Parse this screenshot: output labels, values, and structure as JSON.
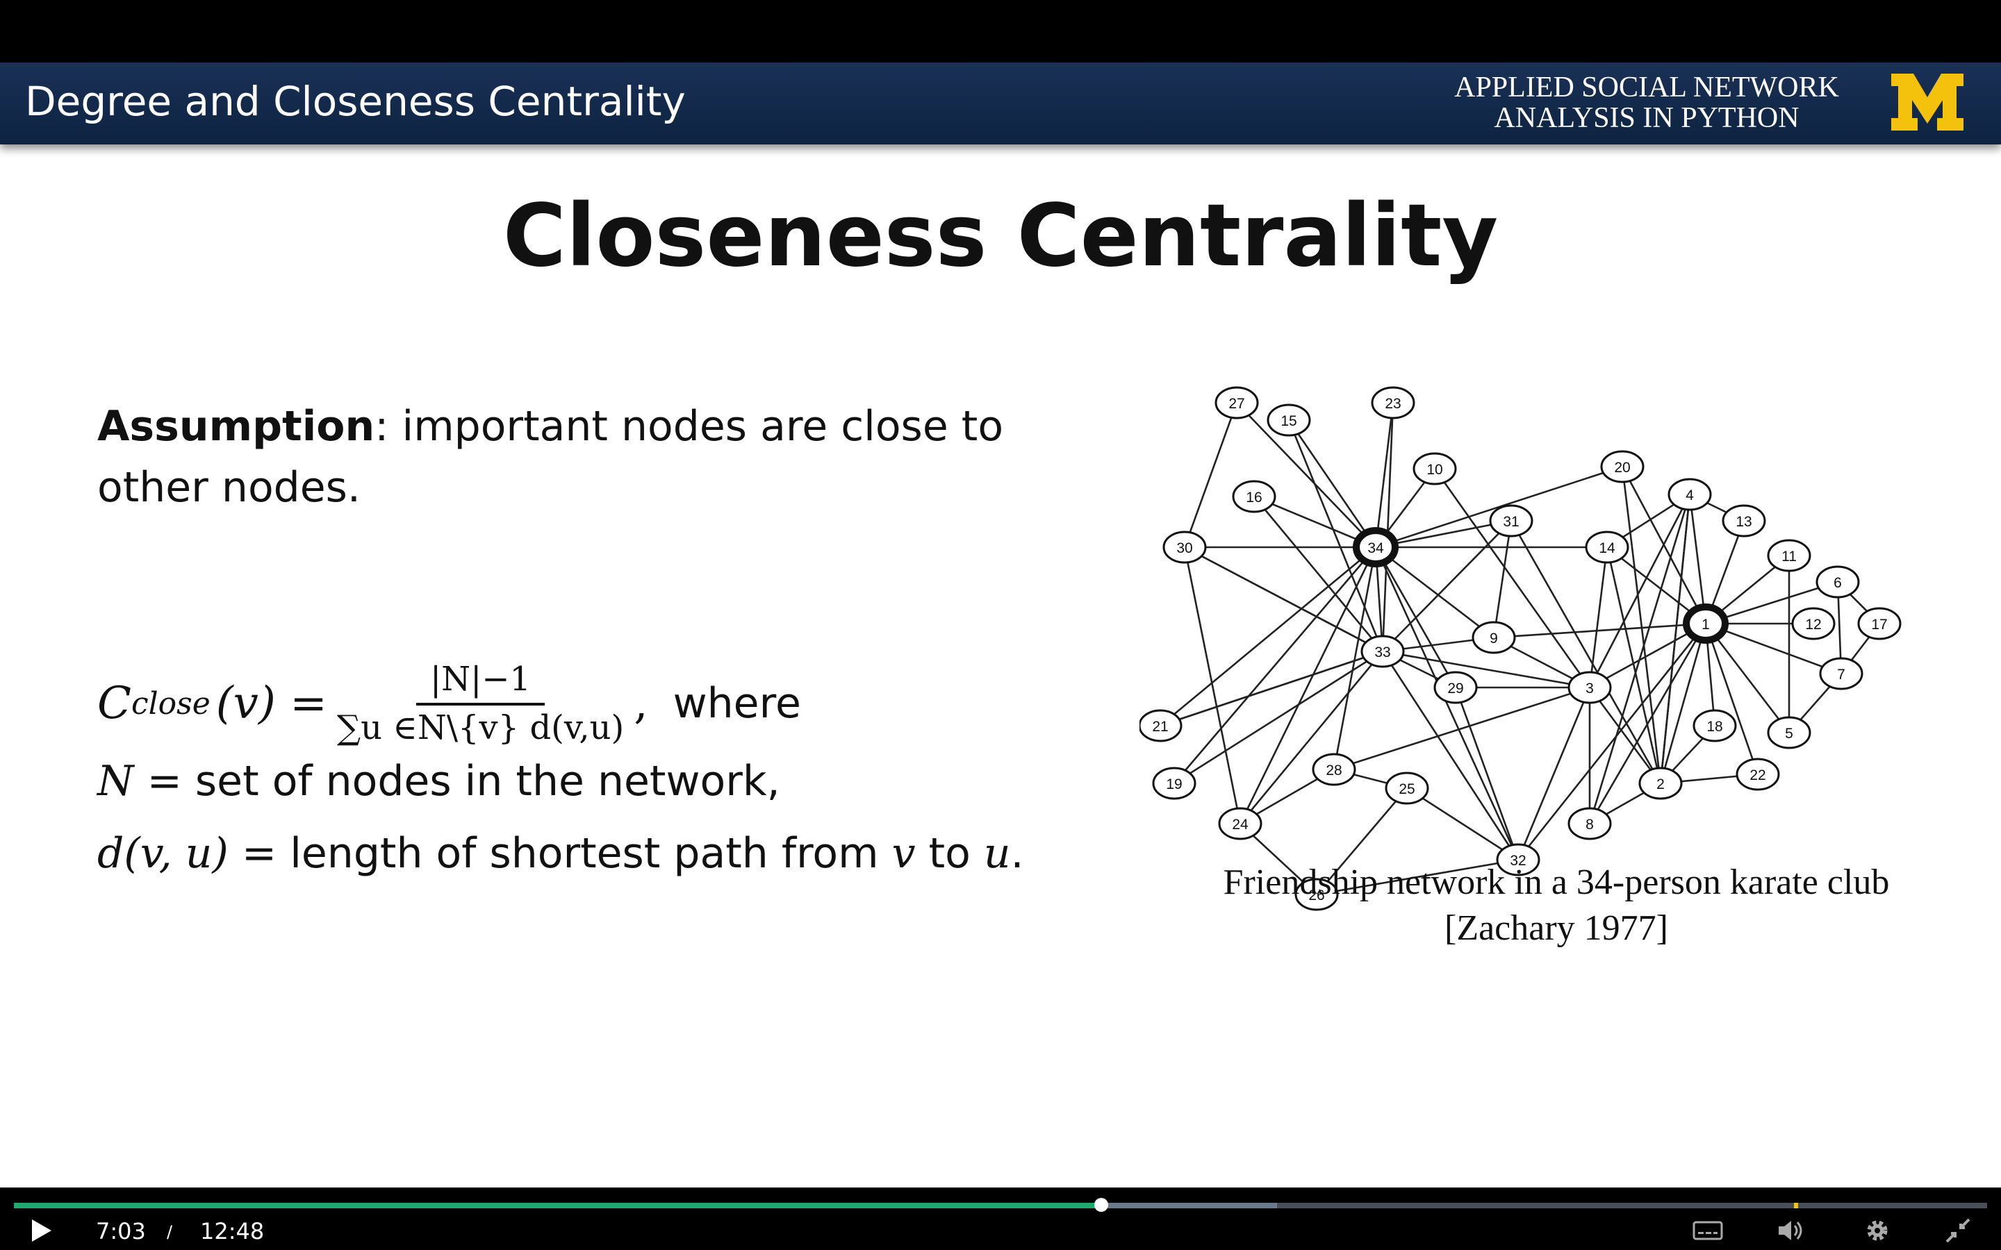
{
  "slide": {
    "header_title": "Degree and Closeness Centrality",
    "course_line1": "APPLIED SOCIAL NETWORK",
    "course_line2": "ANALYSIS IN PYTHON",
    "logo_text": "M",
    "heading": "Closeness Centrality",
    "assumption_label": "Assumption",
    "assumption_text": ": important nodes are close to other nodes.",
    "formula": {
      "lhs_C": "C",
      "lhs_sub": "close",
      "lhs_arg": "(v) =",
      "numerator": "|N|−1",
      "denominator": "∑u ∈N\\{v} d(v,u)",
      "comma": ",",
      "where": "where"
    },
    "def_N_symbol": "N",
    "def_N_text": " = set of nodes in the network,",
    "def_d_symbol": "d(v, u)",
    "def_d_text": " = length of shortest path from ",
    "def_d_v": "v",
    "def_d_to": " to ",
    "def_d_u": "u",
    "def_d_end": ".",
    "caption_line1": "Friendship network in a 34-person karate club",
    "caption_line2": "[Zachary 1977]"
  },
  "network": {
    "nodes": [
      "27",
      "15",
      "23",
      "10",
      "16",
      "34",
      "31",
      "20",
      "4",
      "13",
      "11",
      "6",
      "17",
      "30",
      "14",
      "1",
      "12",
      "7",
      "21",
      "33",
      "9",
      "29",
      "3",
      "18",
      "5",
      "22",
      "19",
      "28",
      "25",
      "2",
      "24",
      "8",
      "32",
      "26"
    ],
    "highlighted": [
      "34",
      "1"
    ],
    "edges": [
      [
        "27",
        "30"
      ],
      [
        "27",
        "34"
      ],
      [
        "15",
        "34"
      ],
      [
        "15",
        "33"
      ],
      [
        "23",
        "34"
      ],
      [
        "23",
        "33"
      ],
      [
        "10",
        "34"
      ],
      [
        "10",
        "3"
      ],
      [
        "16",
        "34"
      ],
      [
        "16",
        "33"
      ],
      [
        "30",
        "34"
      ],
      [
        "30",
        "33"
      ],
      [
        "30",
        "24"
      ],
      [
        "21",
        "34"
      ],
      [
        "21",
        "33"
      ],
      [
        "19",
        "34"
      ],
      [
        "19",
        "33"
      ],
      [
        "34",
        "31"
      ],
      [
        "34",
        "20"
      ],
      [
        "34",
        "14"
      ],
      [
        "34",
        "9"
      ],
      [
        "34",
        "29"
      ],
      [
        "34",
        "28"
      ],
      [
        "34",
        "32"
      ],
      [
        "34",
        "24"
      ],
      [
        "34",
        "33"
      ],
      [
        "33",
        "31"
      ],
      [
        "33",
        "9"
      ],
      [
        "33",
        "3"
      ],
      [
        "33",
        "29"
      ],
      [
        "33",
        "32"
      ],
      [
        "33",
        "24"
      ],
      [
        "33",
        "21"
      ],
      [
        "33",
        "30"
      ],
      [
        "31",
        "9"
      ],
      [
        "31",
        "2"
      ],
      [
        "9",
        "1"
      ],
      [
        "9",
        "3"
      ],
      [
        "29",
        "3"
      ],
      [
        "29",
        "32"
      ],
      [
        "28",
        "24"
      ],
      [
        "28",
        "25"
      ],
      [
        "28",
        "3"
      ],
      [
        "25",
        "26"
      ],
      [
        "25",
        "32"
      ],
      [
        "24",
        "26"
      ],
      [
        "26",
        "32"
      ],
      [
        "32",
        "3"
      ],
      [
        "32",
        "1"
      ],
      [
        "20",
        "1"
      ],
      [
        "20",
        "2"
      ],
      [
        "14",
        "1"
      ],
      [
        "14",
        "2"
      ],
      [
        "14",
        "3"
      ],
      [
        "14",
        "4"
      ],
      [
        "4",
        "1"
      ],
      [
        "4",
        "2"
      ],
      [
        "4",
        "3"
      ],
      [
        "13",
        "1"
      ],
      [
        "13",
        "4"
      ],
      [
        "11",
        "1"
      ],
      [
        "11",
        "5"
      ],
      [
        "6",
        "1"
      ],
      [
        "6",
        "17"
      ],
      [
        "6",
        "7"
      ],
      [
        "17",
        "7"
      ],
      [
        "12",
        "1"
      ],
      [
        "7",
        "1"
      ],
      [
        "5",
        "1"
      ],
      [
        "5",
        "7"
      ],
      [
        "22",
        "1"
      ],
      [
        "22",
        "2"
      ],
      [
        "18",
        "1"
      ],
      [
        "18",
        "2"
      ],
      [
        "8",
        "1"
      ],
      [
        "8",
        "2"
      ],
      [
        "8",
        "3"
      ],
      [
        "8",
        "4"
      ],
      [
        "3",
        "1"
      ],
      [
        "3",
        "2"
      ],
      [
        "2",
        "1"
      ],
      [
        "2",
        "4"
      ]
    ]
  },
  "player": {
    "current_time": "7:03",
    "separator": "/",
    "duration": "12:48",
    "progress_fraction": 0.551,
    "buffered_fraction": 0.64,
    "marker_fraction": 0.902,
    "accent_color": "#1fa870"
  }
}
